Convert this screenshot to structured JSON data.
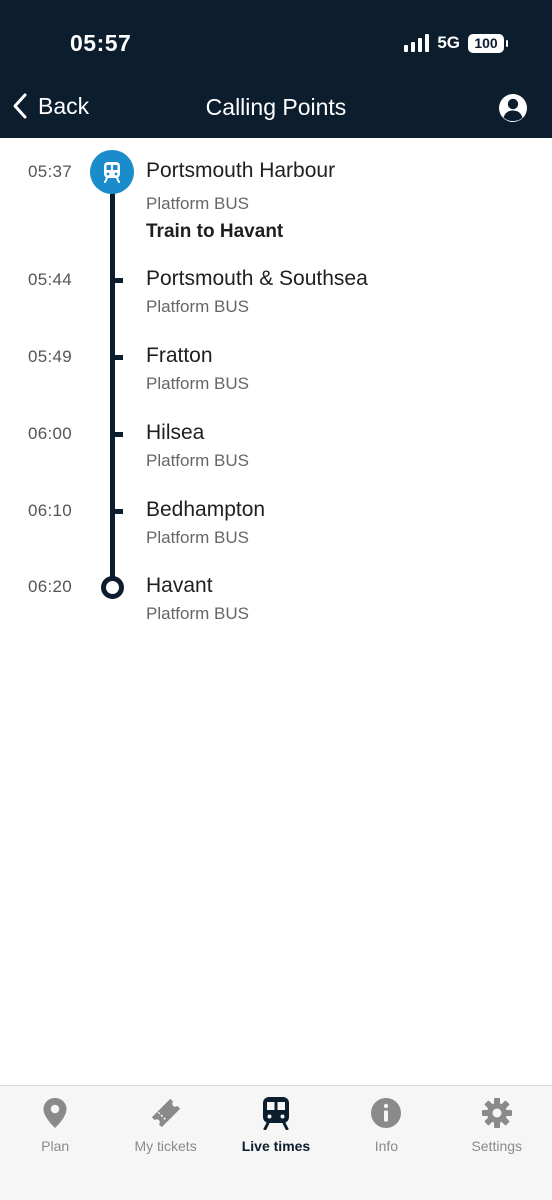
{
  "status": {
    "time": "05:57",
    "network": "5G",
    "battery": "100"
  },
  "header": {
    "back_label": "Back",
    "title": "Calling Points"
  },
  "stops": [
    {
      "time": "05:37",
      "name": "Portsmouth Harbour",
      "platform": "Platform BUS",
      "note": "Train to Havant"
    },
    {
      "time": "05:44",
      "name": "Portsmouth & Southsea",
      "platform": "Platform BUS"
    },
    {
      "time": "05:49",
      "name": "Fratton",
      "platform": "Platform BUS"
    },
    {
      "time": "06:00",
      "name": "Hilsea",
      "platform": "Platform BUS"
    },
    {
      "time": "06:10",
      "name": "Bedhampton",
      "platform": "Platform BUS"
    },
    {
      "time": "06:20",
      "name": "Havant",
      "platform": "Platform BUS"
    }
  ],
  "tabs": [
    {
      "label": "Plan",
      "icon": "location-pin-icon"
    },
    {
      "label": "My tickets",
      "icon": "ticket-icon"
    },
    {
      "label": "Live times",
      "icon": "train-icon",
      "active": true
    },
    {
      "label": "Info",
      "icon": "info-icon"
    },
    {
      "label": "Settings",
      "icon": "gear-icon"
    }
  ],
  "colors": {
    "header_bg": "#0c1d2e",
    "accent": "#1a8ccc",
    "tab_inactive": "#8a8a8a"
  }
}
